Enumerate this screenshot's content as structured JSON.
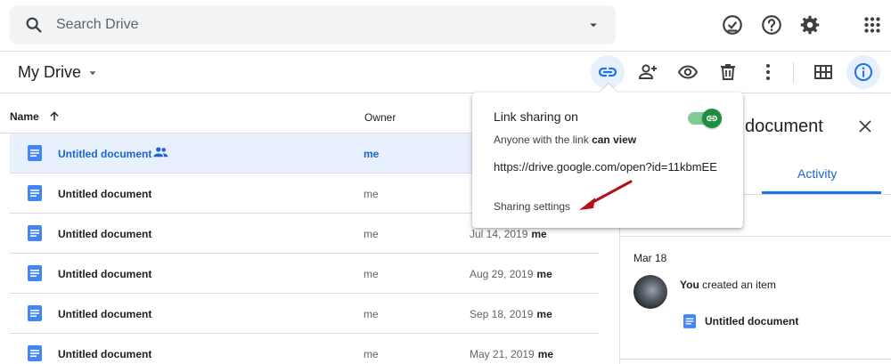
{
  "search": {
    "placeholder": "Search Drive"
  },
  "topbar": {
    "icons": [
      "offline-check-icon",
      "help-icon",
      "settings-icon",
      "apps-icon"
    ]
  },
  "toolbar": {
    "title": "My Drive",
    "actions": [
      "get-link-icon",
      "share-icon",
      "preview-icon",
      "delete-icon",
      "more-icon",
      "grid-view-icon",
      "info-icon"
    ]
  },
  "list": {
    "headers": {
      "name": "Name",
      "owner": "Owner"
    },
    "rows": [
      {
        "name": "Untitled document",
        "owner": "me",
        "modified": "",
        "modified_by": "",
        "shared": true,
        "selected": true
      },
      {
        "name": "Untitled document",
        "owner": "me",
        "modified": "",
        "modified_by": ""
      },
      {
        "name": "Untitled document",
        "owner": "me",
        "modified": "Jul 14, 2019",
        "modified_by": "me"
      },
      {
        "name": "Untitled document",
        "owner": "me",
        "modified": "Aug 29, 2019",
        "modified_by": "me"
      },
      {
        "name": "Untitled document",
        "owner": "me",
        "modified": "Sep 18, 2019",
        "modified_by": "me"
      },
      {
        "name": "Untitled document",
        "owner": "me",
        "modified": "May 21, 2019",
        "modified_by": "me"
      }
    ]
  },
  "panel": {
    "title": "document",
    "tab": "Activity",
    "date": "Mar 18",
    "actor": "You",
    "action": " created an item",
    "item": "Untitled document"
  },
  "popup": {
    "title": "Link sharing on",
    "access_prefix": "Anyone with the link ",
    "access_level": "can view",
    "url": "https://drive.google.com/open?id=11kbmEE",
    "settings_link": "Sharing settings",
    "toggle_on": true
  },
  "colors": {
    "accent": "#1a73e8",
    "selected_bg": "#e8f0fe",
    "doc_blue": "#4285f4",
    "toggle_green": "#1e8e3e",
    "annotation_red": "#b3121a"
  }
}
